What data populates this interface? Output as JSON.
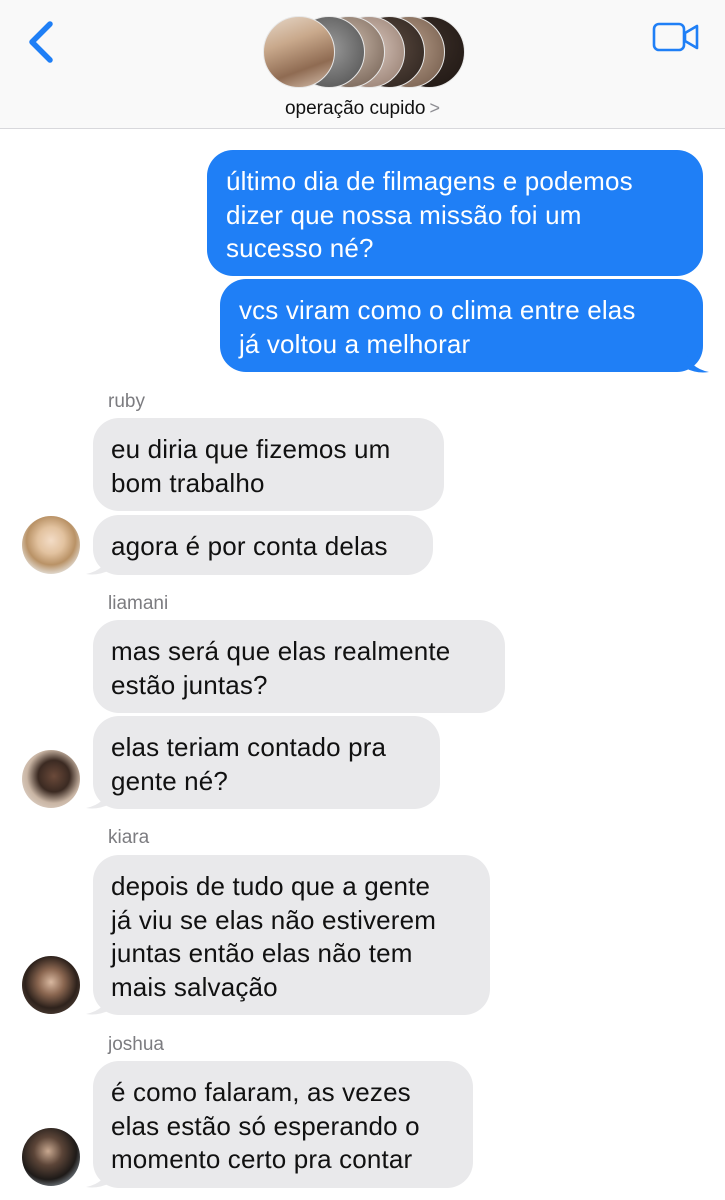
{
  "header": {
    "back_icon": "chevron-left-icon",
    "video_icon": "video-camera-icon",
    "group_name": "operação cupido",
    "group_chevron": ">",
    "accent": "#1f7ff6"
  },
  "messages": [
    {
      "direction": "out",
      "lines": [
        "último dia de filmagens e podemos",
        "dizer que nossa missão foi um",
        "sucesso né?"
      ]
    },
    {
      "direction": "out",
      "lines": [
        "vcs viram como o clima entre elas",
        "já voltou a melhorar"
      ]
    },
    {
      "direction": "in",
      "sender": "ruby",
      "lines": [
        "eu diria que fizemos um",
        "bom trabalho"
      ]
    },
    {
      "direction": "in",
      "lines": [
        "agora é por conta delas"
      ]
    },
    {
      "direction": "in",
      "sender": "liamani",
      "lines": [
        "mas será que elas realmente",
        "estão juntas?"
      ]
    },
    {
      "direction": "in",
      "lines": [
        "elas teriam contado pra",
        "gente né?"
      ]
    },
    {
      "direction": "in",
      "sender": "kiara",
      "lines": [
        "depois de tudo que a gente",
        "já viu se elas não estiverem",
        "juntas então elas não tem",
        "mais salvação"
      ]
    },
    {
      "direction": "in",
      "sender": "joshua",
      "lines": [
        "é como falaram, as vezes",
        "elas estão só esperando o",
        "momento certo pra contar"
      ]
    }
  ],
  "colors": {
    "outgoing_bubble": "#1f7ff6",
    "incoming_bubble": "#e9e9eb",
    "sender_label": "#7c7c80"
  }
}
